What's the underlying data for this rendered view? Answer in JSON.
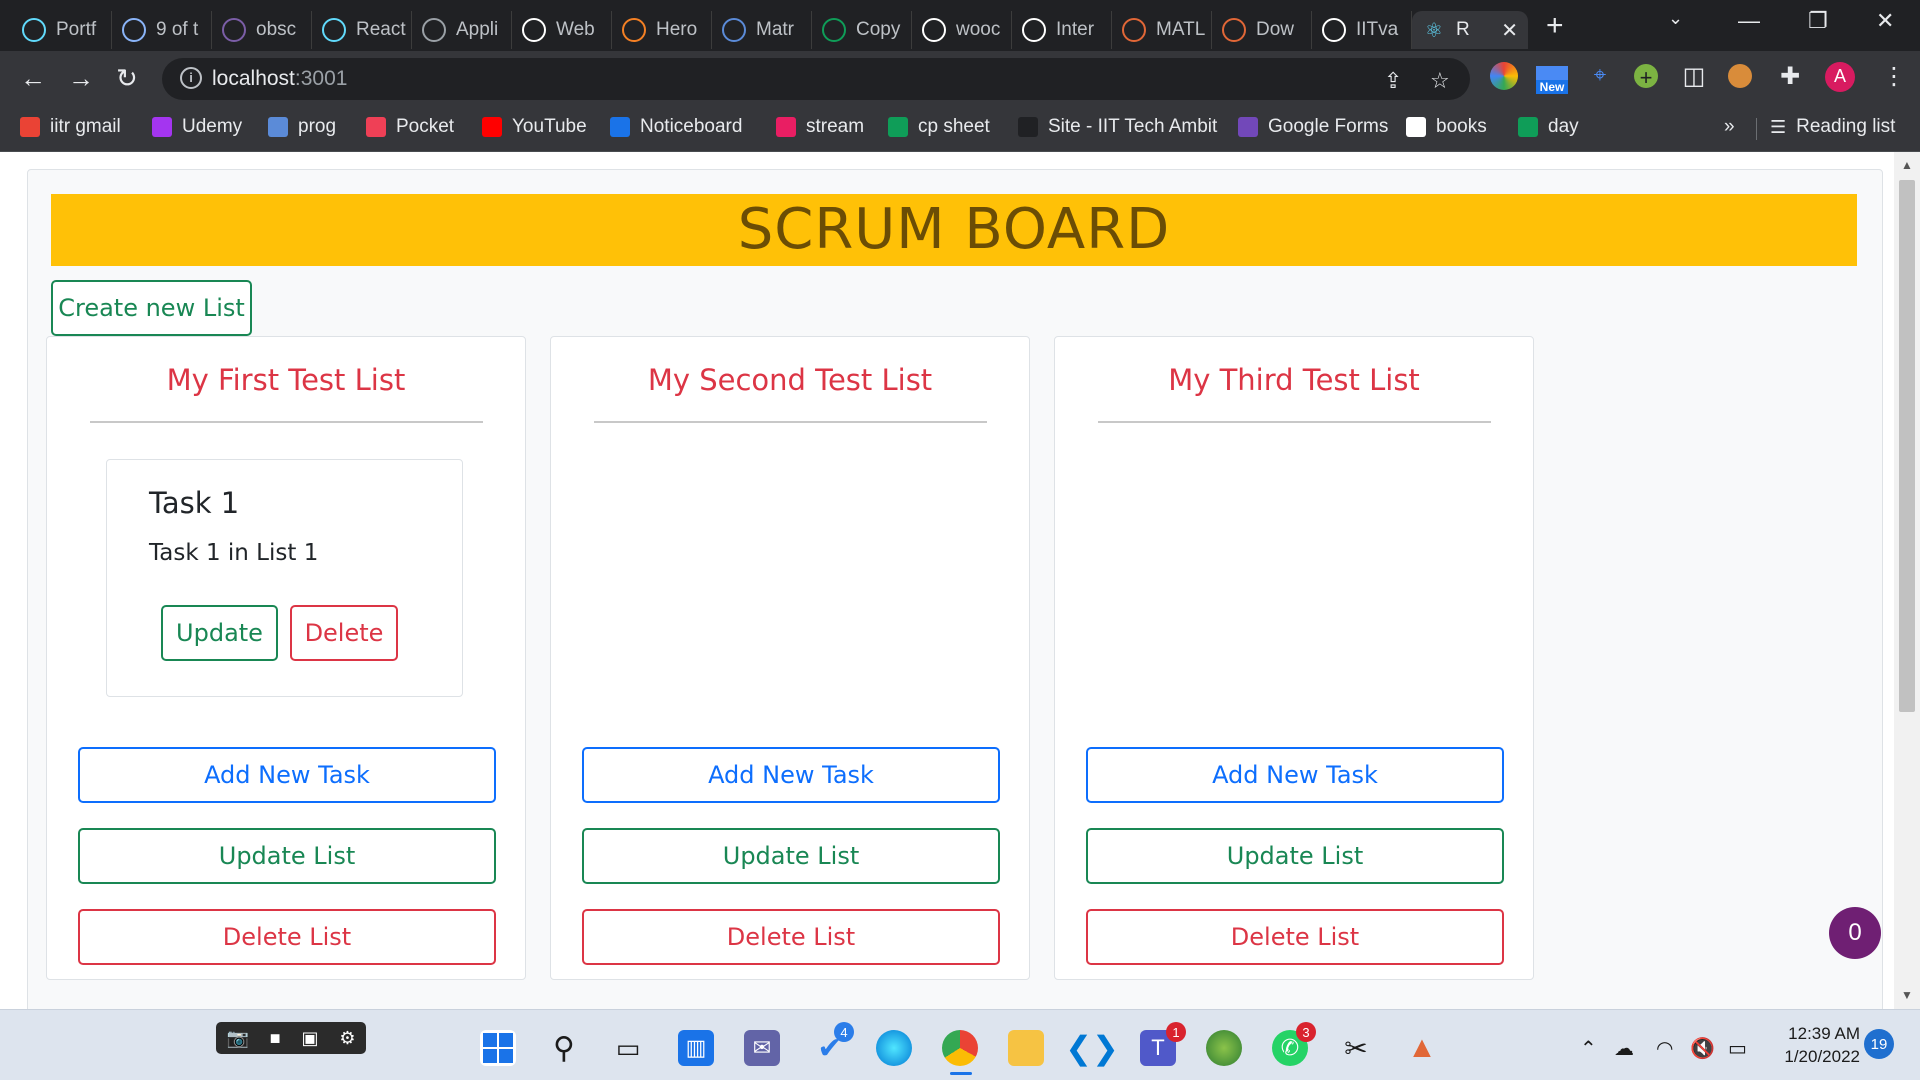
{
  "browser": {
    "tabs": [
      {
        "label": "Portf",
        "icon": "react-icon",
        "color": "#61dafb"
      },
      {
        "label": "9 of t",
        "icon": "gear-icon",
        "color": "#8ab4f8"
      },
      {
        "label": "obsc",
        "icon": "heroku-icon",
        "color": "#7b5ea7"
      },
      {
        "label": "React",
        "icon": "react-icon",
        "color": "#61dafb"
      },
      {
        "label": "Appli",
        "icon": "globe-icon",
        "color": "#9aa0a6"
      },
      {
        "label": "Web",
        "icon": "google-icon",
        "color": "#ffffff"
      },
      {
        "label": "Hero",
        "icon": "stackoverflow-icon",
        "color": "#f48024"
      },
      {
        "label": "Matr",
        "icon": "mountain-icon",
        "color": "#5b8bd8"
      },
      {
        "label": "Copy",
        "icon": "sheets-plus-icon",
        "color": "#0f9d58"
      },
      {
        "label": "wooc",
        "icon": "google-icon",
        "color": "#ffffff"
      },
      {
        "label": "Inter",
        "icon": "github-icon",
        "color": "#ffffff"
      },
      {
        "label": "MATL",
        "icon": "matlab-icon",
        "color": "#e16737"
      },
      {
        "label": "Dow",
        "icon": "matlab-icon",
        "color": "#e16737"
      },
      {
        "label": "IITva",
        "icon": "github-icon",
        "color": "#ffffff"
      }
    ],
    "active_tab": {
      "label": "R",
      "icon": "react-icon",
      "color": "#61dafb"
    },
    "url_host": "localhost",
    "url_port": ":3001",
    "bookmarks": [
      {
        "label": "iitr gmail",
        "color": "#ea4335"
      },
      {
        "label": "Udemy",
        "color": "#a435f0"
      },
      {
        "label": "prog",
        "color": "#5b8bd8"
      },
      {
        "label": "Pocket",
        "color": "#ef4056"
      },
      {
        "label": "YouTube",
        "color": "#ff0000"
      },
      {
        "label": "Noticeboard",
        "color": "#1a73e8"
      },
      {
        "label": "stream",
        "color": "#e91e63"
      },
      {
        "label": "cp sheet",
        "color": "#0f9d58"
      },
      {
        "label": "Site - IIT Tech Ambit",
        "color": "#202124"
      },
      {
        "label": "Google Forms",
        "color": "#7248b9"
      },
      {
        "label": "books",
        "color": "#ffffff"
      },
      {
        "label": "day",
        "color": "#0f9d58"
      }
    ],
    "bookmarks_overflow": "»",
    "reading_list": "Reading list",
    "ext_new_badge": "New",
    "profile_letter": "A"
  },
  "page": {
    "title": "SCRUM BOARD",
    "create_list_label": "Create new List",
    "lists": [
      {
        "title": "My First Test List",
        "tasks": [
          {
            "title": "Task 1",
            "description": "Task 1 in List 1",
            "update_label": "Update",
            "delete_label": "Delete"
          }
        ],
        "add_task_label": "Add New Task",
        "update_list_label": "Update List",
        "delete_list_label": "Delete List"
      },
      {
        "title": "My Second Test List",
        "tasks": [],
        "add_task_label": "Add New Task",
        "update_list_label": "Update List",
        "delete_list_label": "Delete List"
      },
      {
        "title": "My Third Test List",
        "tasks": [],
        "add_task_label": "Add New Task",
        "update_list_label": "Update List",
        "delete_list_label": "Delete List"
      }
    ],
    "floating_badge": "0"
  },
  "taskbar": {
    "badges": {
      "todo": "4",
      "teams": "1",
      "whatsapp": "3"
    },
    "clock_time": "12:39 AM",
    "clock_date": "1/20/2022",
    "notifications": "19"
  },
  "colors": {
    "banner": "#ffc107",
    "title_text": "#6b4d05",
    "list_title": "#dc3545",
    "success": "#198754",
    "primary": "#0d6efd",
    "danger": "#dc3545"
  }
}
